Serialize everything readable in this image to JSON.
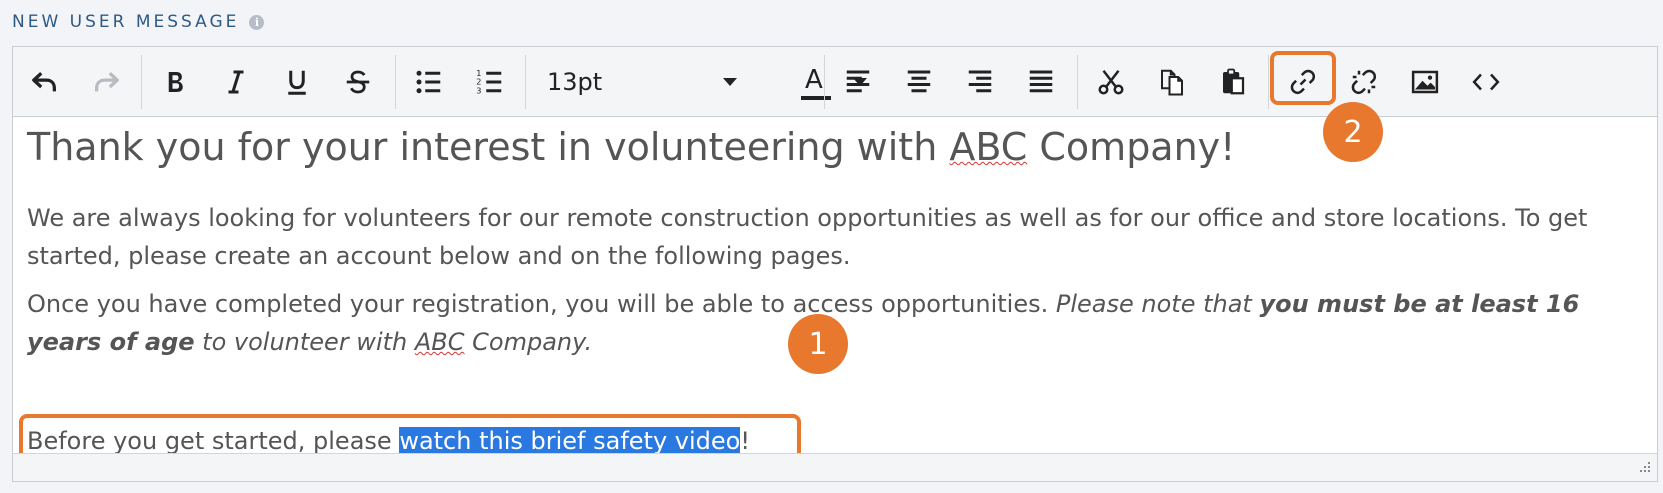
{
  "section_label": "NEW USER MESSAGE",
  "info_icon": "info-icon",
  "toolbar": {
    "buttons": [
      "undo-icon",
      "redo-icon",
      "bold-icon",
      "italic-icon",
      "underline-icon",
      "strikethrough-icon",
      "bullet-list-icon",
      "numbered-list-icon",
      "align-left-icon",
      "align-center-icon",
      "align-right-icon",
      "justify-icon",
      "cut-icon",
      "copy-icon",
      "paste-icon",
      "link-icon",
      "unlink-icon",
      "image-icon",
      "code-icon"
    ],
    "font_size": "13pt",
    "font_color_letter": "A"
  },
  "content": {
    "heading": "Thank you for your interest in volunteering with ABC Company!",
    "p1": "We are always looking for volunteers for our remote construction opportunities as well as for our office and store locations. To get started, please create an account below and on the following pages.",
    "p2_text": "Once you have completed your registration, you will be able to access opportunities.",
    "p2_italic_1": "Please note that",
    "p2_bold_italic": "you must be at least 16 years of age",
    "p2_italic_2": "to volunteer with",
    "p2_italic_abc": "ABC",
    "p2_italic_3": "Company.",
    "p3_prefix": "Before you get started, please",
    "p3_selected": "watch this brief safety video",
    "p3_suffix": "!"
  },
  "annotations": {
    "badge1": "1",
    "badge2": "2"
  },
  "colors": {
    "accent": "#e8782e",
    "selection": "#2a79e0",
    "label": "#2f5a84"
  }
}
